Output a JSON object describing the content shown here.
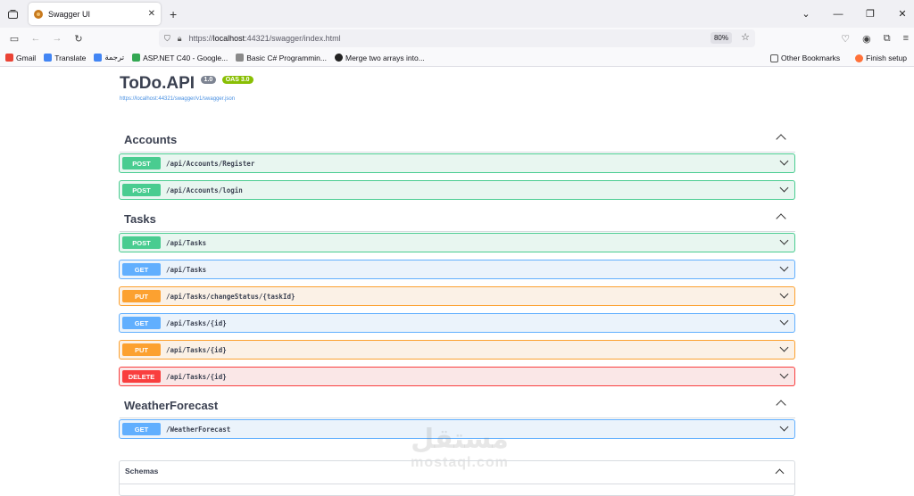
{
  "browser": {
    "tab_title": "Swagger UI",
    "new_tab": "+",
    "url_prefix": "https://",
    "url_host": "localhost",
    "url_rest": ":44321/swagger/index.html",
    "zoom": "80%",
    "bookmarks": [
      {
        "label": "Gmail",
        "icon": "gmail-icon",
        "color": "#ea4335"
      },
      {
        "label": "Translate",
        "icon": "translate-icon",
        "color": "#4285f4"
      },
      {
        "label": "ترجمة",
        "icon": "translate-icon",
        "color": "#4285f4"
      },
      {
        "label": "ASP.NET C40 - Google...",
        "icon": "drive-icon",
        "color": "#34a853"
      },
      {
        "label": "Basic C# Programmin...",
        "icon": "page-icon",
        "color": "#8a8a8a"
      },
      {
        "label": "Merge two arrays into...",
        "icon": "github-icon",
        "color": "#222222"
      }
    ],
    "other_bookmarks": "Other Bookmarks",
    "finish_setup": "Finish setup"
  },
  "api": {
    "title": "ToDo.API",
    "version": "1.0",
    "oas": "OAS 3.0",
    "spec_url": "https://localhost:44321/swagger/v1/swagger.json"
  },
  "tags": [
    {
      "name": "Accounts"
    },
    {
      "name": "Tasks"
    },
    {
      "name": "WeatherForecast"
    }
  ],
  "operations": [
    {
      "method": "POST",
      "path": "/api/Accounts/Register"
    },
    {
      "method": "POST",
      "path": "/api/Accounts/login"
    },
    {
      "method": "POST",
      "path": "/api/Tasks"
    },
    {
      "method": "GET",
      "path": "/api/Tasks"
    },
    {
      "method": "PUT",
      "path": "/api/Tasks/changeStatus/{taskId}"
    },
    {
      "method": "GET",
      "path": "/api/Tasks/{id}"
    },
    {
      "method": "PUT",
      "path": "/api/Tasks/{id}"
    },
    {
      "method": "DELETE",
      "path": "/api/Tasks/{id}"
    },
    {
      "method": "GET",
      "path": "/WeatherForecast"
    }
  ],
  "schemas": {
    "label": "Schemas"
  },
  "watermark": {
    "arabic": "مستقل",
    "latin": "mostaql.com"
  }
}
